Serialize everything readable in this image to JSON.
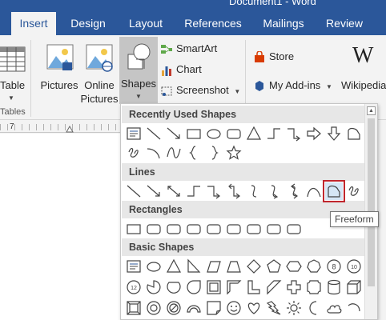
{
  "window": {
    "title": "Document1 - Word"
  },
  "tabs": [
    {
      "label": "Insert",
      "active": true
    },
    {
      "label": "Design",
      "active": false
    },
    {
      "label": "Layout",
      "active": false
    },
    {
      "label": "References",
      "active": false
    },
    {
      "label": "Mailings",
      "active": false
    },
    {
      "label": "Review",
      "active": false
    }
  ],
  "ribbon": {
    "table": {
      "label": "Table",
      "group": "Tables"
    },
    "pictures": {
      "label": "Pictures"
    },
    "online_pictures": {
      "line1": "Online",
      "line2": "Pictures"
    },
    "shapes": {
      "label": "Shapes"
    },
    "smartart": {
      "label": "SmartArt"
    },
    "chart": {
      "label": "Chart"
    },
    "screenshot": {
      "label": "Screenshot"
    },
    "store": {
      "label": "Store"
    },
    "my_addins": {
      "label": "My Add-ins"
    },
    "wikipedia": {
      "label": "Wikipedia",
      "icon": "W"
    }
  },
  "ruler": {
    "number": "7"
  },
  "shapes_gallery": {
    "sections": [
      {
        "title": "Recently Used Shapes"
      },
      {
        "title": "Lines"
      },
      {
        "title": "Rectangles"
      },
      {
        "title": "Basic Shapes"
      }
    ],
    "selected_shape": "Freeform"
  },
  "tooltip": {
    "text": "Freeform"
  },
  "colors": {
    "accent": "#2b579a",
    "selection": "#c0262d"
  }
}
